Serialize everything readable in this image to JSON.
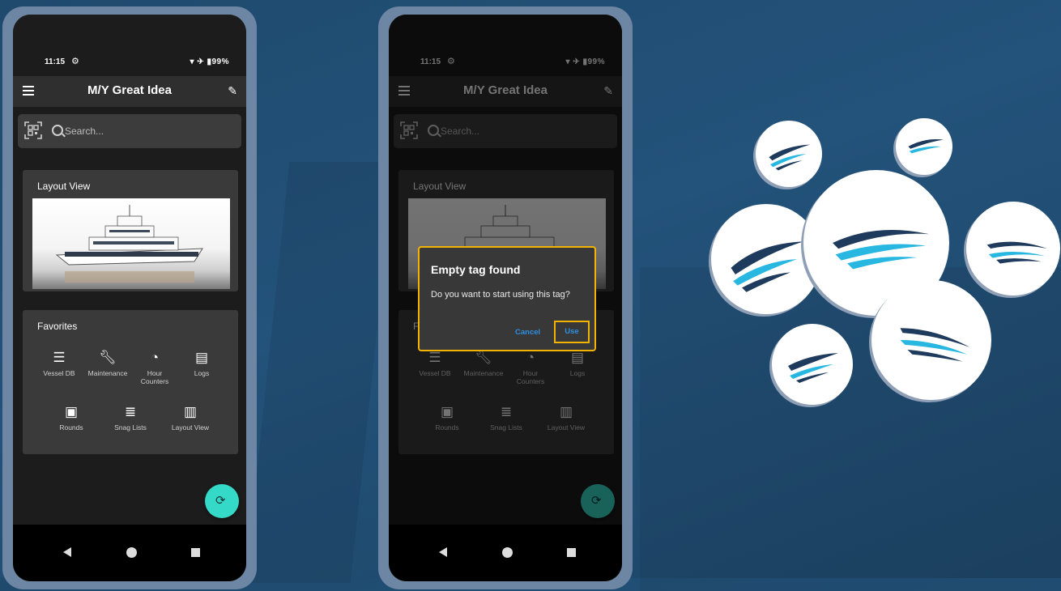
{
  "status": {
    "time": "11:15",
    "battery": "99%"
  },
  "app": {
    "title": "M/Y Great Idea"
  },
  "search": {
    "placeholder": "Search..."
  },
  "layout_card": {
    "title": "Layout View"
  },
  "favorites": {
    "title": "Favorites",
    "items": [
      {
        "label": "Vessel DB",
        "icon": "database-icon"
      },
      {
        "label": "Maintenance",
        "icon": "wrench-icon"
      },
      {
        "label": "Hour Counters",
        "icon": "clock-icon"
      },
      {
        "label": "Logs",
        "icon": "book-icon"
      },
      {
        "label": "Rounds",
        "icon": "clipboard-icon"
      },
      {
        "label": "Snag Lists",
        "icon": "list-icon"
      },
      {
        "label": "Layout View",
        "icon": "map-icon"
      }
    ]
  },
  "dialog": {
    "title": "Empty tag found",
    "message": "Do you want to start using this tag?",
    "cancel": "Cancel",
    "use": "Use"
  },
  "colors": {
    "fab": "#35d9c7",
    "highlight": "#f2b400",
    "link": "#2f8fe0",
    "background": "#23527a"
  }
}
